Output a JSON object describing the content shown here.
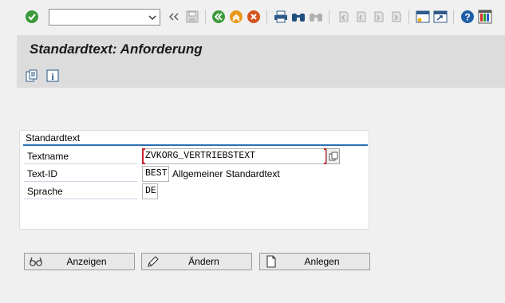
{
  "toolbar": {
    "command_field_value": "",
    "icons": [
      "enter-check-icon",
      "command-dropdown-icon",
      "collapse-icon",
      "save-icon",
      "back-icon",
      "exit-icon",
      "cancel-icon",
      "print-icon",
      "find-icon",
      "find-next-icon",
      "first-page-icon",
      "prev-page-icon",
      "next-page-icon",
      "last-page-icon",
      "new-session-icon",
      "shortcut-icon",
      "help-icon",
      "customize-layout-icon"
    ]
  },
  "title": "Standardtext: Anforderung",
  "app_toolbar": {
    "icons": [
      "text-copy-icon",
      "info-icon"
    ]
  },
  "group": {
    "title": "Standardtext",
    "rows": [
      {
        "label": "Textname",
        "value": "ZVKORG_VERTRIEBSTEXT",
        "description": ""
      },
      {
        "label": "Text-ID",
        "value": "BEST",
        "description": "Allgemeiner Standardtext"
      },
      {
        "label": "Sprache",
        "value": "DE",
        "description": ""
      }
    ]
  },
  "buttons": [
    {
      "label": "Anzeigen",
      "icon": "glasses-icon"
    },
    {
      "label": "Ändern",
      "icon": "pencil-icon"
    },
    {
      "label": "Anlegen",
      "icon": "new-document-icon"
    }
  ],
  "colors": {
    "accent_rule": "#2a6fb0",
    "required_marker": "#c8202a",
    "title_band": "#dcdcdc",
    "background": "#f0f0f0"
  }
}
